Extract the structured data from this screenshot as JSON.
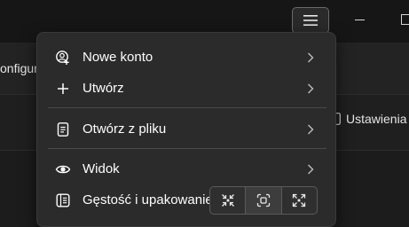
{
  "background": {
    "left_text": "onfigur",
    "right_text": "Ustawienia"
  },
  "menu": {
    "items": [
      {
        "label": "Nowe konto",
        "icon": "add-account-icon"
      },
      {
        "label": "Utwórz",
        "icon": "plus-icon"
      },
      {
        "label": "Otwórz z pliku",
        "icon": "file-icon"
      },
      {
        "label": "Widok",
        "icon": "eye-icon"
      },
      {
        "label": "Gęstość i upakowanie",
        "icon": "density-icon"
      }
    ],
    "density_options": [
      "compact",
      "default",
      "relaxed"
    ],
    "density_selected": "default"
  }
}
